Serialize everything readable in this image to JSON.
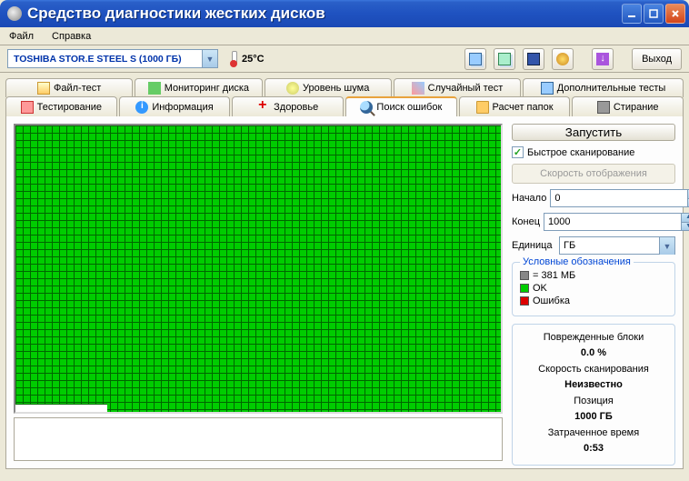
{
  "title": "Средство диагностики жестких дисков",
  "menu": {
    "file": "Файл",
    "help": "Справка"
  },
  "drive": "TOSHIBA STOR.E STEEL S   (1000 ГБ)",
  "temperature": "25°C",
  "exit_btn": "Выход",
  "tabs": {
    "file_test": "Файл-тест",
    "disk_monitor": "Мониторинг диска",
    "noise": "Уровень шума",
    "random": "Случайный тест",
    "extra": "Дополнительные тесты",
    "testing": "Тестирование",
    "info": "Информация",
    "health": "Здоровье",
    "errors": "Поиск ошибок",
    "folders": "Расчет папок",
    "erase": "Стирание"
  },
  "controls": {
    "run": "Запустить",
    "fast_scan": "Быстрое сканирование",
    "display_speed": "Скорость отображения",
    "start_label": "Начало",
    "start_value": "0",
    "end_label": "Конец",
    "end_value": "1000",
    "unit_label": "Единица",
    "unit_value": "ГБ"
  },
  "legend": {
    "title": "Условные обозначения",
    "block_size": "= 381 МБ",
    "ok": "OK",
    "error": "Ошибка"
  },
  "stats": {
    "damaged_label": "Поврежденные блоки",
    "damaged_value": "0.0 %",
    "scan_speed_label": "Скорость сканирования",
    "scan_speed_value": "Неизвестно",
    "position_label": "Позиция",
    "position_value": "1000 ГБ",
    "elapsed_label": "Затраченное время",
    "elapsed_value": "0:53"
  }
}
